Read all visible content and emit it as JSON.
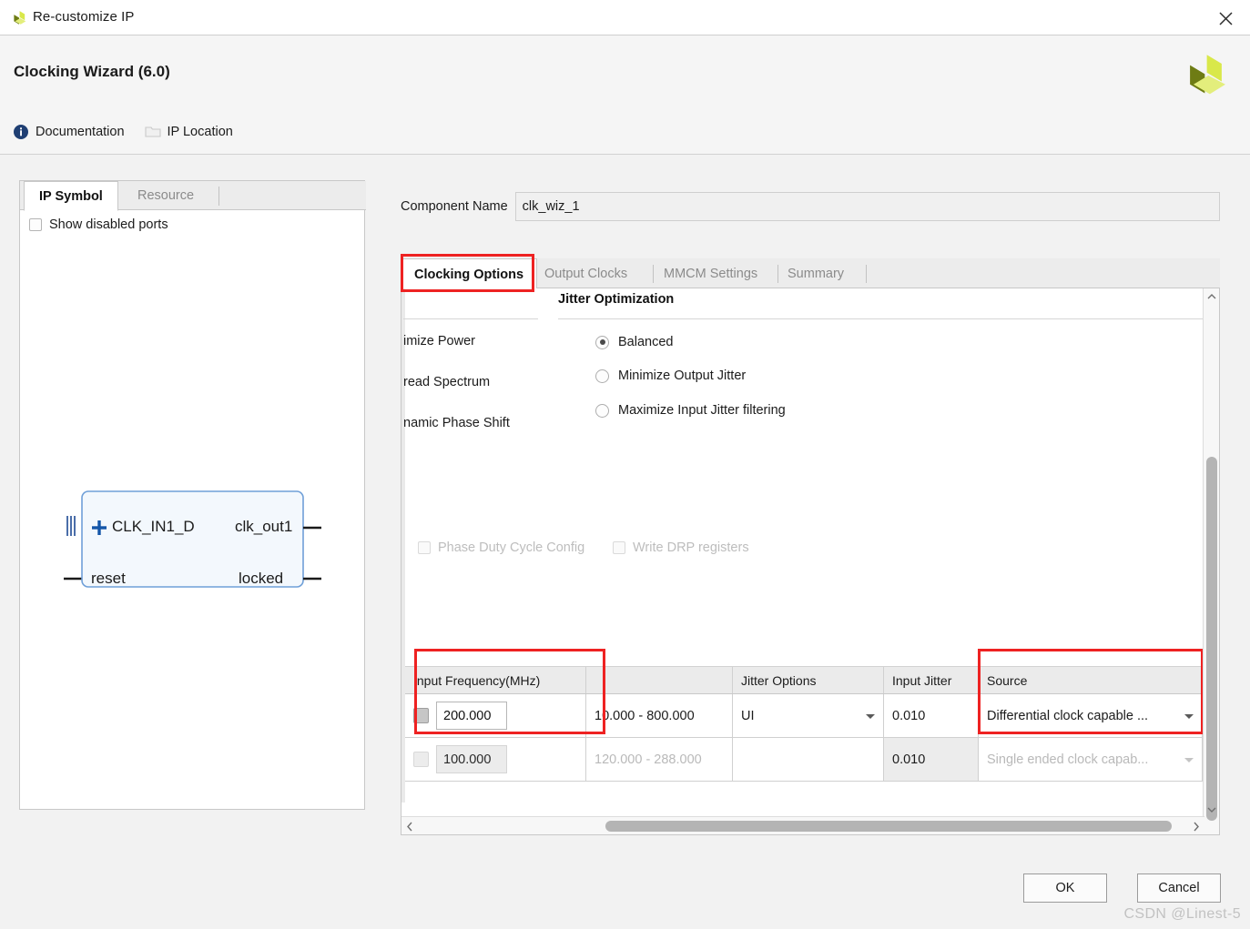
{
  "window": {
    "title": "Re-customize IP",
    "app_icon": "xilinx-logo-icon",
    "close_icon": "close-icon"
  },
  "header": {
    "title": "Clocking Wizard (6.0)",
    "logo_icon": "xilinx-logo-icon",
    "links": [
      {
        "label": "Documentation",
        "icon": "info-icon"
      },
      {
        "label": "IP Location",
        "icon": "folder-icon"
      }
    ]
  },
  "left_panel": {
    "tabs": [
      {
        "label": "IP Symbol",
        "active": true
      },
      {
        "label": "Resource",
        "active": false
      }
    ],
    "show_disabled_ports": {
      "label": "Show disabled ports",
      "checked": false
    },
    "symbol": {
      "inputs": [
        "CLK_IN1_D",
        "reset"
      ],
      "outputs": [
        "clk_out1",
        "locked"
      ],
      "bus_expand_icon": "plus-icon"
    }
  },
  "main": {
    "component_name": {
      "label": "Component Name",
      "value": "clk_wiz_1"
    },
    "tabs": [
      {
        "label": "Clocking Options",
        "active": true
      },
      {
        "label": "Output Clocks",
        "active": false
      },
      {
        "label": "MMCM Settings",
        "active": false
      },
      {
        "label": "Summary",
        "active": false
      }
    ],
    "clipped_left_labels": [
      "imize Power",
      "read Spectrum",
      "namic Phase Shift"
    ],
    "jitter": {
      "title": "Jitter Optimization",
      "options": [
        {
          "label": "Balanced",
          "selected": true
        },
        {
          "label": "Minimize Output Jitter",
          "selected": false
        },
        {
          "label": "Maximize Input Jitter filtering",
          "selected": false
        }
      ]
    },
    "bottom_checkboxes": [
      {
        "label": "Phase Duty Cycle Config",
        "checked": false,
        "disabled": true
      },
      {
        "label": "Write DRP registers",
        "checked": false,
        "disabled": true
      }
    ],
    "table": {
      "headers": [
        "Input Frequency(MHz)",
        "",
        "Jitter Options",
        "Input Jitter",
        "Source"
      ],
      "rows": [
        {
          "enabled": true,
          "freq": "200.000",
          "range": "10.000 - 800.000",
          "jitter_options": "UI",
          "input_jitter": "0.010",
          "source": "Differential clock capable ..."
        },
        {
          "enabled": false,
          "freq": "100.000",
          "range": "120.000 - 288.000",
          "jitter_options": "",
          "input_jitter": "0.010",
          "source": "Single ended clock capab..."
        }
      ]
    },
    "scrollbars": {
      "vertical": {
        "up_icon": "chevron-up-icon",
        "down_icon": "chevron-down-icon"
      },
      "horizontal": {
        "left_icon": "chevron-left-icon",
        "right_icon": "chevron-right-icon"
      }
    }
  },
  "footer": {
    "ok_label": "OK",
    "cancel_label": "Cancel",
    "watermark": "CSDN @Linest-5"
  },
  "colors": {
    "highlight": "#ee2222",
    "accent": "#1f3f73",
    "logo_dark": "#6e7c14",
    "logo_light": "#d9e84a"
  }
}
